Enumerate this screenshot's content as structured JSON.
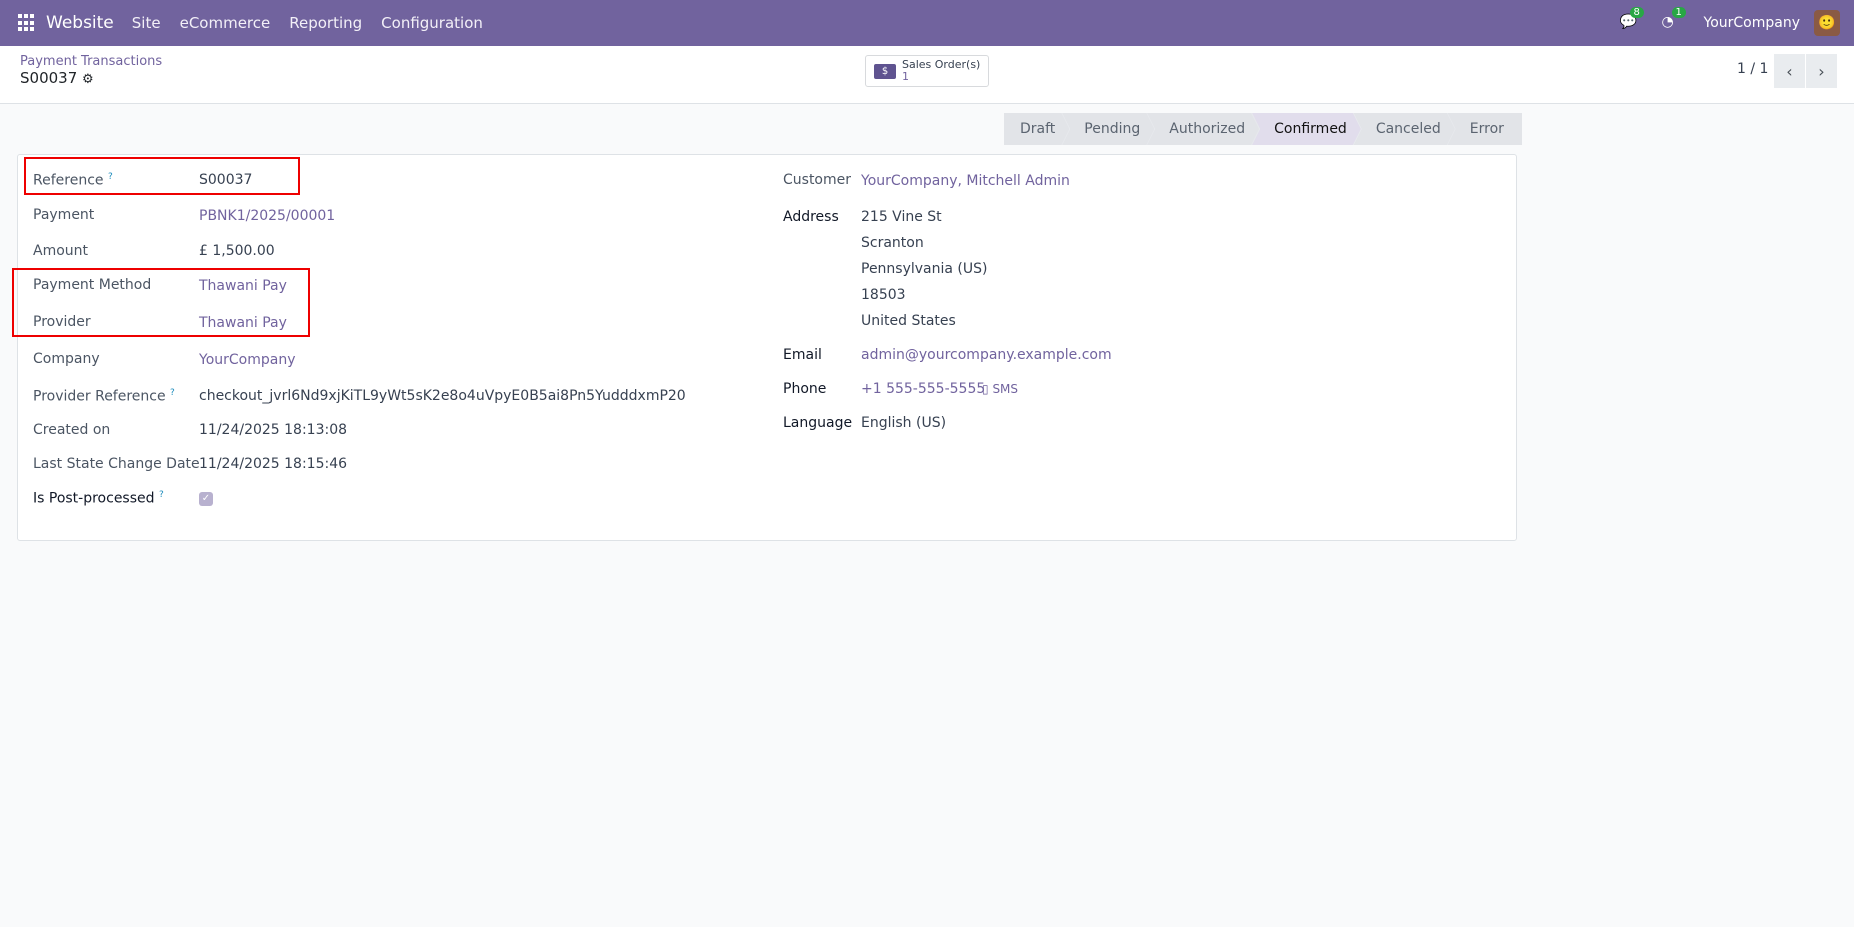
{
  "navbar": {
    "app": "Website",
    "menus": [
      "Site",
      "eCommerce",
      "Reporting",
      "Configuration"
    ],
    "messages_count": "8",
    "activities_count": "1",
    "company": "YourCompany"
  },
  "breadcrumb": {
    "parent": "Payment Transactions",
    "current": "S00037"
  },
  "smart_button": {
    "label": "Sales Order(s)",
    "count": "1"
  },
  "pager": {
    "value": "1 / 1"
  },
  "statusbar": {
    "stages": [
      "Draft",
      "Pending",
      "Authorized",
      "Confirmed",
      "Canceled",
      "Error"
    ],
    "active": "Confirmed"
  },
  "left_fields": {
    "reference": {
      "label": "Reference",
      "value": "S00037"
    },
    "payment": {
      "label": "Payment",
      "value": "PBNK1/2025/00001"
    },
    "amount": {
      "label": "Amount",
      "value": "£ 1,500.00"
    },
    "payment_method": {
      "label": "Payment Method",
      "value": "Thawani Pay"
    },
    "provider": {
      "label": "Provider",
      "value": "Thawani Pay"
    },
    "company": {
      "label": "Company",
      "value": "YourCompany"
    },
    "provider_reference": {
      "label": "Provider Reference",
      "value": "checkout_jvrl6Nd9xjKiTL9yWt5sK2e8o4uVpyE0B5ai8Pn5YudddxmP20"
    },
    "created_on": {
      "label": "Created on",
      "value": "11/24/2025 18:13:08"
    },
    "last_state_change": {
      "label": "Last State Change Date",
      "value": "11/24/2025 18:15:46"
    },
    "is_post_processed": {
      "label": "Is Post-processed",
      "checked": true
    }
  },
  "right_fields": {
    "customer": {
      "label": "Customer",
      "value": "YourCompany, Mitchell Admin"
    },
    "address": {
      "label": "Address",
      "lines": [
        "215 Vine St",
        "Scranton",
        "Pennsylvania (US)",
        "18503",
        "United States"
      ]
    },
    "email": {
      "label": "Email",
      "value": "admin@yourcompany.example.com"
    },
    "phone": {
      "label": "Phone",
      "value": "+1 555-555-5555",
      "sms": "SMS"
    },
    "language": {
      "label": "Language",
      "value": "English (US)"
    }
  },
  "help_mark": "?"
}
